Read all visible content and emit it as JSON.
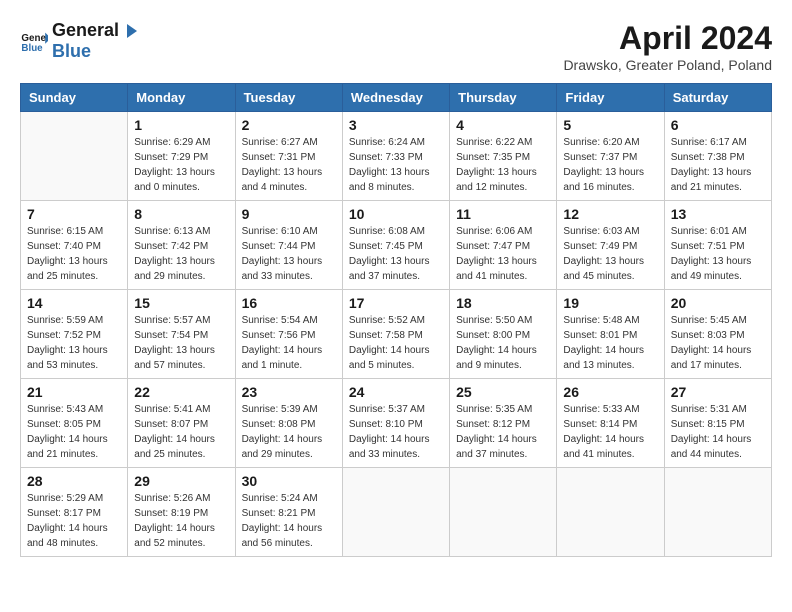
{
  "app": {
    "name_general": "General",
    "name_blue": "Blue"
  },
  "header": {
    "month_year": "April 2024",
    "location": "Drawsko, Greater Poland, Poland"
  },
  "weekdays": [
    "Sunday",
    "Monday",
    "Tuesday",
    "Wednesday",
    "Thursday",
    "Friday",
    "Saturday"
  ],
  "weeks": [
    [
      {
        "day": "",
        "info": ""
      },
      {
        "day": "1",
        "info": "Sunrise: 6:29 AM\nSunset: 7:29 PM\nDaylight: 13 hours\nand 0 minutes."
      },
      {
        "day": "2",
        "info": "Sunrise: 6:27 AM\nSunset: 7:31 PM\nDaylight: 13 hours\nand 4 minutes."
      },
      {
        "day": "3",
        "info": "Sunrise: 6:24 AM\nSunset: 7:33 PM\nDaylight: 13 hours\nand 8 minutes."
      },
      {
        "day": "4",
        "info": "Sunrise: 6:22 AM\nSunset: 7:35 PM\nDaylight: 13 hours\nand 12 minutes."
      },
      {
        "day": "5",
        "info": "Sunrise: 6:20 AM\nSunset: 7:37 PM\nDaylight: 13 hours\nand 16 minutes."
      },
      {
        "day": "6",
        "info": "Sunrise: 6:17 AM\nSunset: 7:38 PM\nDaylight: 13 hours\nand 21 minutes."
      }
    ],
    [
      {
        "day": "7",
        "info": "Sunrise: 6:15 AM\nSunset: 7:40 PM\nDaylight: 13 hours\nand 25 minutes."
      },
      {
        "day": "8",
        "info": "Sunrise: 6:13 AM\nSunset: 7:42 PM\nDaylight: 13 hours\nand 29 minutes."
      },
      {
        "day": "9",
        "info": "Sunrise: 6:10 AM\nSunset: 7:44 PM\nDaylight: 13 hours\nand 33 minutes."
      },
      {
        "day": "10",
        "info": "Sunrise: 6:08 AM\nSunset: 7:45 PM\nDaylight: 13 hours\nand 37 minutes."
      },
      {
        "day": "11",
        "info": "Sunrise: 6:06 AM\nSunset: 7:47 PM\nDaylight: 13 hours\nand 41 minutes."
      },
      {
        "day": "12",
        "info": "Sunrise: 6:03 AM\nSunset: 7:49 PM\nDaylight: 13 hours\nand 45 minutes."
      },
      {
        "day": "13",
        "info": "Sunrise: 6:01 AM\nSunset: 7:51 PM\nDaylight: 13 hours\nand 49 minutes."
      }
    ],
    [
      {
        "day": "14",
        "info": "Sunrise: 5:59 AM\nSunset: 7:52 PM\nDaylight: 13 hours\nand 53 minutes."
      },
      {
        "day": "15",
        "info": "Sunrise: 5:57 AM\nSunset: 7:54 PM\nDaylight: 13 hours\nand 57 minutes."
      },
      {
        "day": "16",
        "info": "Sunrise: 5:54 AM\nSunset: 7:56 PM\nDaylight: 14 hours\nand 1 minute."
      },
      {
        "day": "17",
        "info": "Sunrise: 5:52 AM\nSunset: 7:58 PM\nDaylight: 14 hours\nand 5 minutes."
      },
      {
        "day": "18",
        "info": "Sunrise: 5:50 AM\nSunset: 8:00 PM\nDaylight: 14 hours\nand 9 minutes."
      },
      {
        "day": "19",
        "info": "Sunrise: 5:48 AM\nSunset: 8:01 PM\nDaylight: 14 hours\nand 13 minutes."
      },
      {
        "day": "20",
        "info": "Sunrise: 5:45 AM\nSunset: 8:03 PM\nDaylight: 14 hours\nand 17 minutes."
      }
    ],
    [
      {
        "day": "21",
        "info": "Sunrise: 5:43 AM\nSunset: 8:05 PM\nDaylight: 14 hours\nand 21 minutes."
      },
      {
        "day": "22",
        "info": "Sunrise: 5:41 AM\nSunset: 8:07 PM\nDaylight: 14 hours\nand 25 minutes."
      },
      {
        "day": "23",
        "info": "Sunrise: 5:39 AM\nSunset: 8:08 PM\nDaylight: 14 hours\nand 29 minutes."
      },
      {
        "day": "24",
        "info": "Sunrise: 5:37 AM\nSunset: 8:10 PM\nDaylight: 14 hours\nand 33 minutes."
      },
      {
        "day": "25",
        "info": "Sunrise: 5:35 AM\nSunset: 8:12 PM\nDaylight: 14 hours\nand 37 minutes."
      },
      {
        "day": "26",
        "info": "Sunrise: 5:33 AM\nSunset: 8:14 PM\nDaylight: 14 hours\nand 41 minutes."
      },
      {
        "day": "27",
        "info": "Sunrise: 5:31 AM\nSunset: 8:15 PM\nDaylight: 14 hours\nand 44 minutes."
      }
    ],
    [
      {
        "day": "28",
        "info": "Sunrise: 5:29 AM\nSunset: 8:17 PM\nDaylight: 14 hours\nand 48 minutes."
      },
      {
        "day": "29",
        "info": "Sunrise: 5:26 AM\nSunset: 8:19 PM\nDaylight: 14 hours\nand 52 minutes."
      },
      {
        "day": "30",
        "info": "Sunrise: 5:24 AM\nSunset: 8:21 PM\nDaylight: 14 hours\nand 56 minutes."
      },
      {
        "day": "",
        "info": ""
      },
      {
        "day": "",
        "info": ""
      },
      {
        "day": "",
        "info": ""
      },
      {
        "day": "",
        "info": ""
      }
    ]
  ]
}
